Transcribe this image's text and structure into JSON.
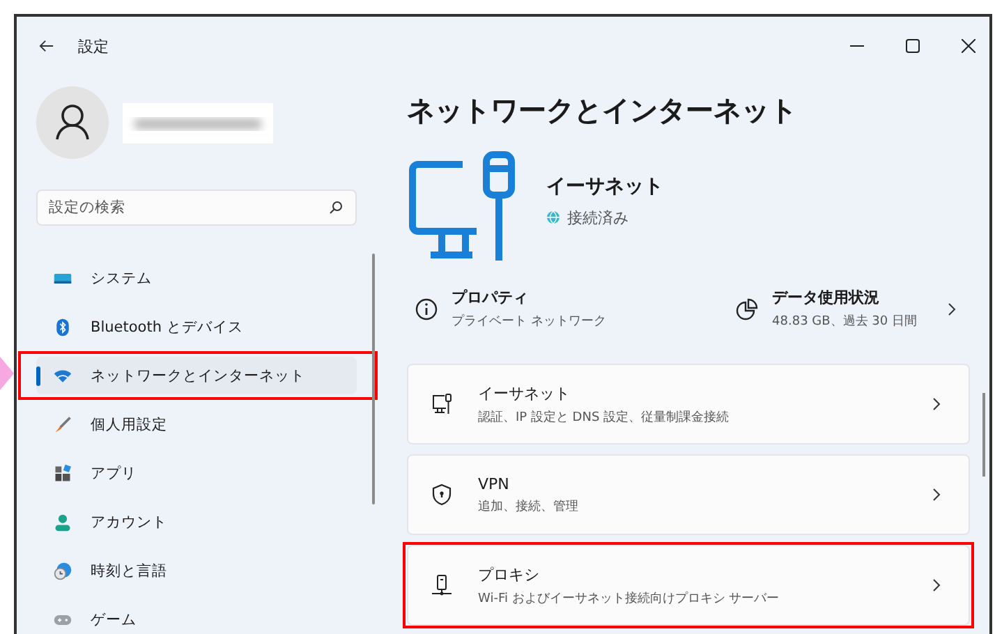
{
  "window": {
    "title": "設定"
  },
  "search": {
    "placeholder": "設定の検索"
  },
  "sidebar": {
    "items": [
      {
        "label": "システム",
        "kind": "system",
        "selected": false,
        "highlighted": false
      },
      {
        "label": "Bluetooth とデバイス",
        "kind": "bluetooth",
        "selected": false,
        "highlighted": false
      },
      {
        "label": "ネットワークとインターネット",
        "kind": "network",
        "selected": true,
        "highlighted": true
      },
      {
        "label": "個人用設定",
        "kind": "brush",
        "selected": false,
        "highlighted": false
      },
      {
        "label": "アプリ",
        "kind": "apps",
        "selected": false,
        "highlighted": false
      },
      {
        "label": "アカウント",
        "kind": "account",
        "selected": false,
        "highlighted": false
      },
      {
        "label": "時刻と言語",
        "kind": "time",
        "selected": false,
        "highlighted": false
      },
      {
        "label": "ゲーム",
        "kind": "game",
        "selected": false,
        "highlighted": false
      }
    ]
  },
  "page": {
    "title": "ネットワークとインターネット",
    "connection": {
      "name": "イーサネット",
      "status": "接続済み"
    },
    "properties": {
      "title": "プロパティ",
      "subtitle": "プライベート ネットワーク"
    },
    "data_usage": {
      "title": "データ使用状況",
      "subtitle": "48.83 GB、過去 30 日間"
    },
    "cards": [
      {
        "kind": "ethernet",
        "title": "イーサネット",
        "subtitle": "認証、IP 設定と DNS 設定、従量制課金接続",
        "highlighted": false
      },
      {
        "kind": "vpn",
        "title": "VPN",
        "subtitle": "追加、接続、管理",
        "highlighted": false
      },
      {
        "kind": "proxy",
        "title": "プロキシ",
        "subtitle": "Wi-Fi およびイーサネット接続向けプロキシ サーバー",
        "highlighted": true
      }
    ]
  }
}
